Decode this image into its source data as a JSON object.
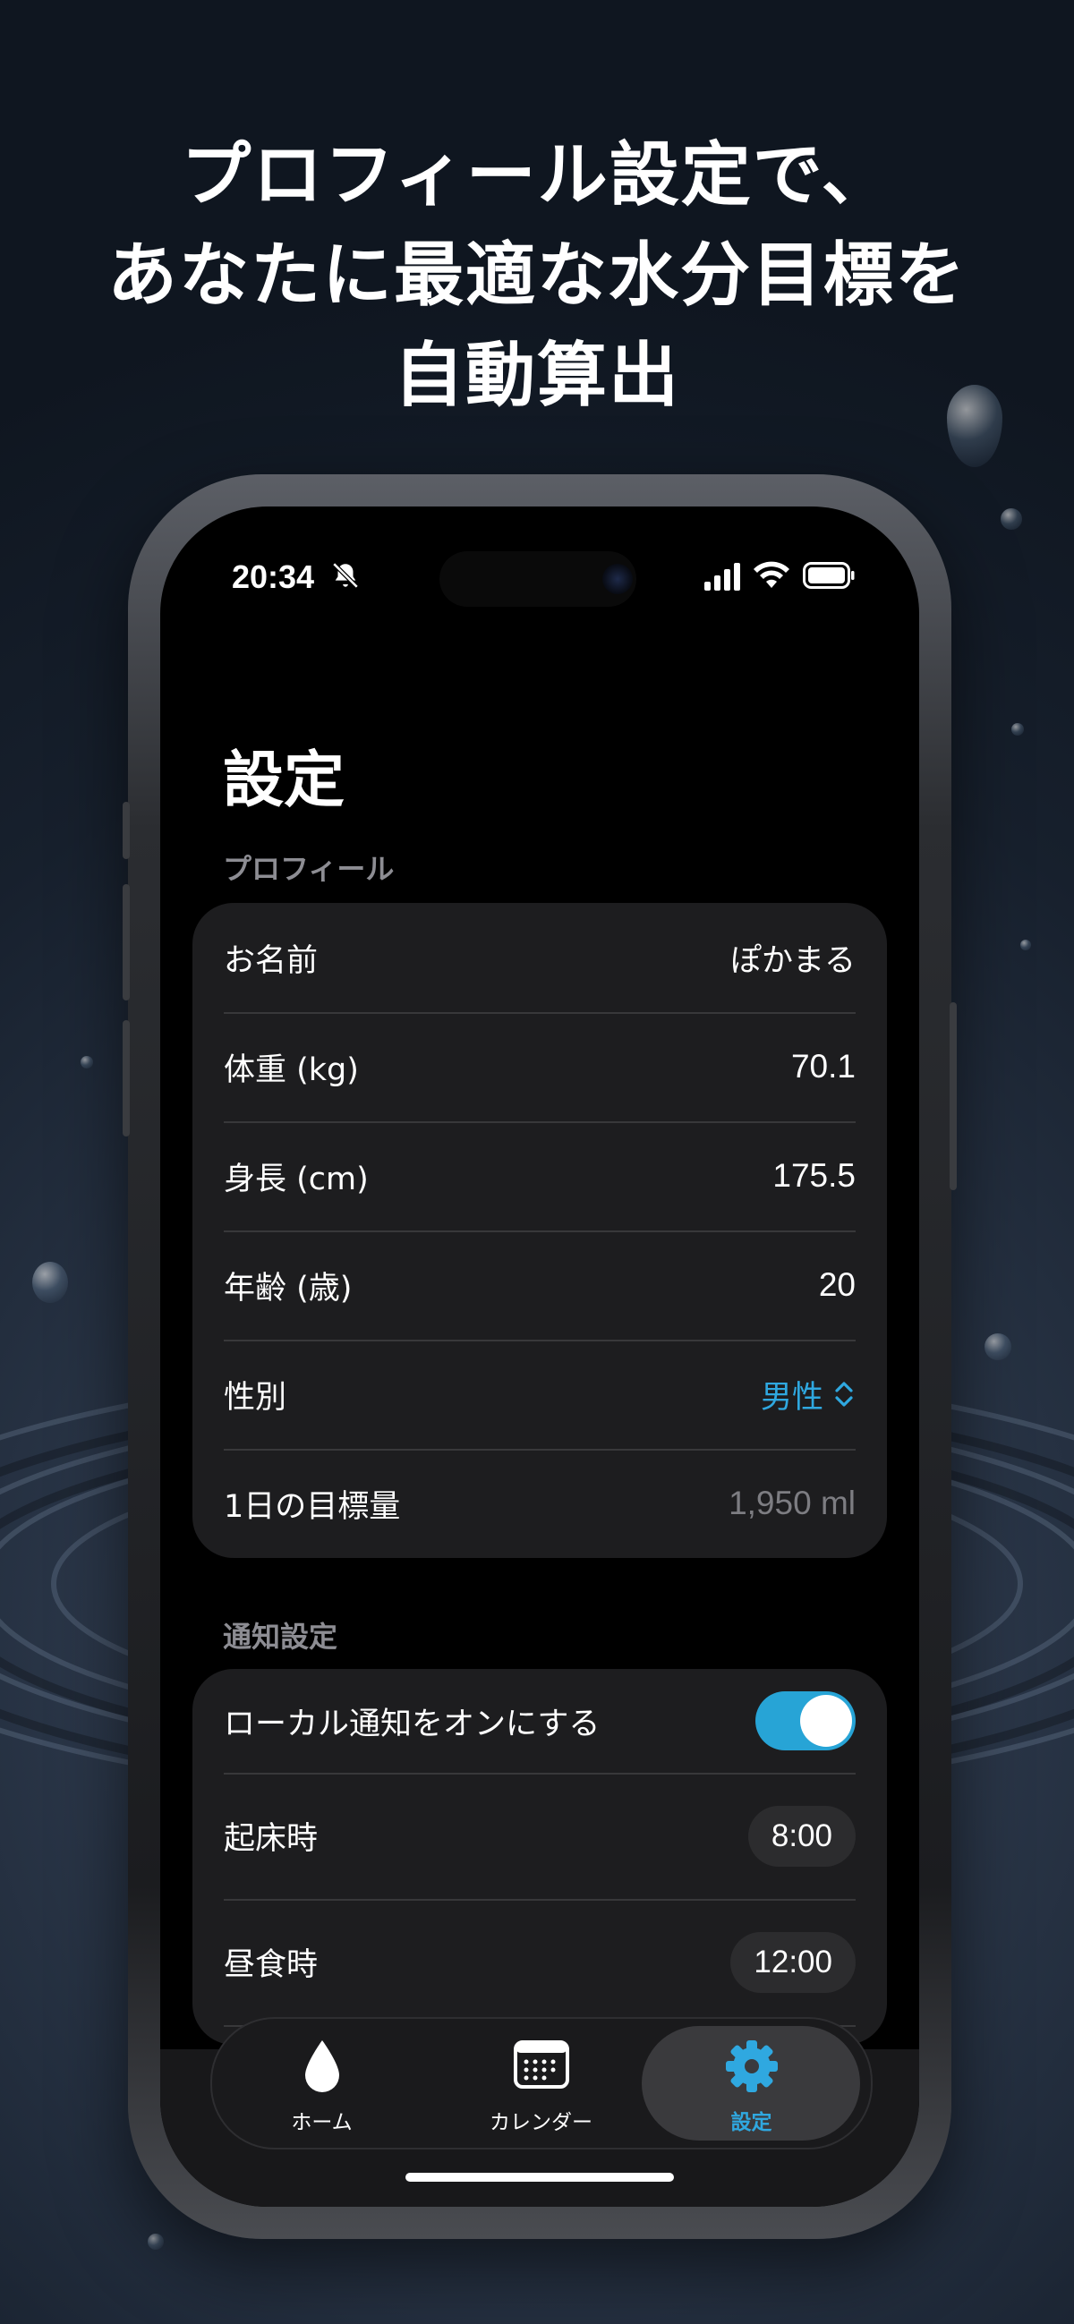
{
  "headline": {
    "line1": "プロフィール設定で、",
    "line2": "あなたに最適な水分目標を",
    "line3": "自動算出"
  },
  "status_bar": {
    "time": "20:34"
  },
  "page": {
    "title": "設定"
  },
  "profile": {
    "header": "プロフィール",
    "rows": [
      {
        "label": "お名前",
        "value": "ぽかまる"
      },
      {
        "label": "体重 (kg)",
        "value": "70.1"
      },
      {
        "label": "身長 (cm)",
        "value": "175.5"
      },
      {
        "label": "年齢 (歳)",
        "value": "20"
      },
      {
        "label": "性別",
        "value": "男性"
      },
      {
        "label": "1日の目標量",
        "value": "1,950 ml"
      }
    ]
  },
  "notifications": {
    "header": "通知設定",
    "toggle_label": "ローカル通知をオンにする",
    "toggle_on": true,
    "rows": [
      {
        "label": "起床時",
        "value": "8:00"
      },
      {
        "label": "昼食時",
        "value": "12:00"
      }
    ]
  },
  "tabbar": {
    "items": [
      {
        "label": "ホーム",
        "icon": "water-drop-icon"
      },
      {
        "label": "カレンダー",
        "icon": "calendar-icon"
      },
      {
        "label": "設定",
        "icon": "gear-icon"
      }
    ],
    "active_index": 2
  },
  "colors": {
    "accent": "#2fa8e0",
    "toggle": "#27a4d6",
    "group_bg": "#1d1d1f"
  }
}
